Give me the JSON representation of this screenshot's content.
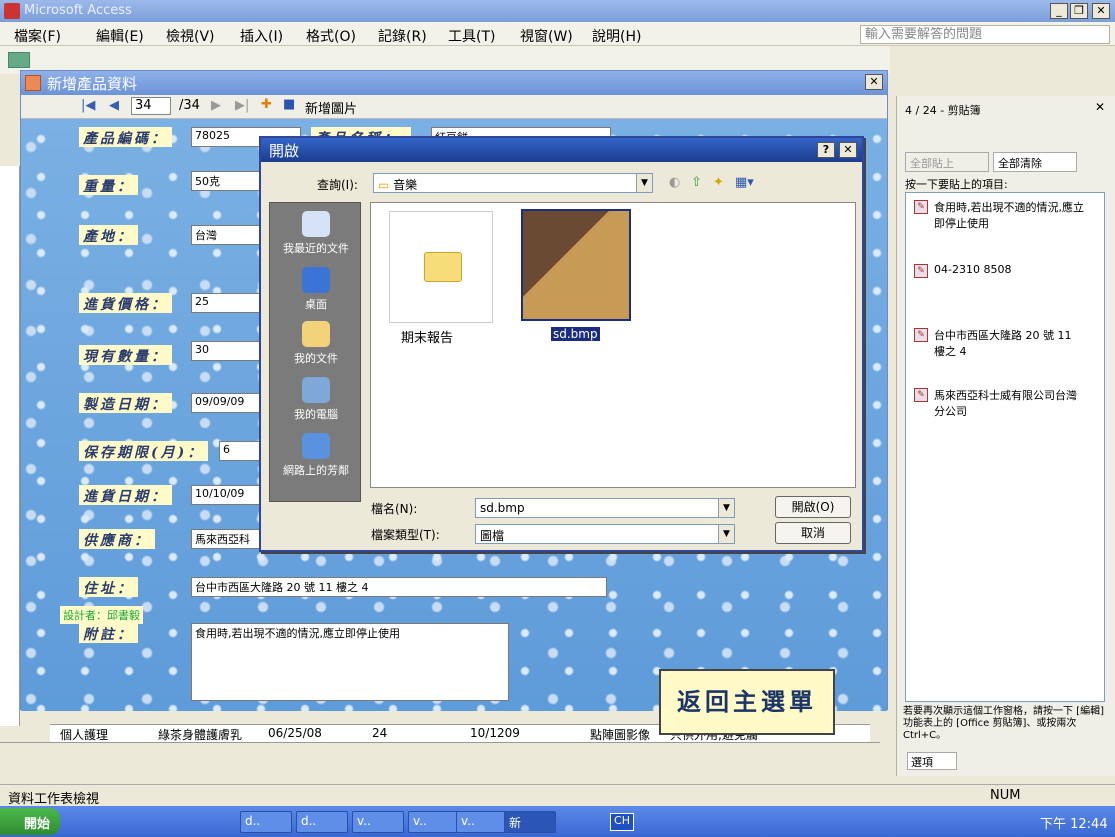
{
  "app": {
    "title": "Microsoft Access"
  },
  "menu": {
    "items": [
      "檔案(F)",
      "編輯(E)",
      "檢視(V)",
      "插入(I)",
      "格式(O)",
      "記錄(R)",
      "工具(T)",
      "視窗(W)",
      "說明(H)"
    ],
    "ask_placeholder": "輸入需要解答的問題"
  },
  "form": {
    "title": "新增產品資料",
    "nav": {
      "current": "34",
      "total": "/34",
      "add_picture": "新增圖片"
    },
    "fields": [
      {
        "label": "產品編碼：",
        "value": "78025"
      },
      {
        "label": "重量：",
        "value": "50克"
      },
      {
        "label": "產地：",
        "value": "台灣"
      },
      {
        "label": "進貨價格：",
        "value": "25"
      },
      {
        "label": "現有數量：",
        "value": "30"
      },
      {
        "label": "製造日期：",
        "value": "09/09/09"
      },
      {
        "label": "保存期限(月)：",
        "value": "6"
      },
      {
        "label": "進貨日期：",
        "value": "10/10/09"
      },
      {
        "label": "供應商：",
        "value": "馬來西亞科"
      },
      {
        "label": "住址：",
        "value": "台中市西區大隆路 20 號 11 樓之 4"
      },
      {
        "label": "附註：",
        "value": "食用時,若出現不適的情況,應立即停止使用"
      }
    ],
    "name_label_partial": "產品名稱：",
    "name_value_partial": "紅豆餅",
    "designer": "設計者：邱書毅",
    "return_button": "返回主選單"
  },
  "sheet": {
    "row": [
      "個人護理",
      "綠茶身體護膚乳",
      "06/25/08",
      "24",
      "10/1209",
      "點陣圖影像",
      "只供外用,避免觸"
    ]
  },
  "dialog": {
    "title": "開啟",
    "lookin_label": "查詢(I):",
    "lookin_value": "音樂",
    "places": [
      "我最近的文件",
      "桌面",
      "我的文件",
      "我的電腦",
      "網路上的芳鄰"
    ],
    "files": [
      {
        "name": "期末報告",
        "type": "folder"
      },
      {
        "name": "sd.bmp",
        "type": "image"
      }
    ],
    "filename_label": "檔名(N):",
    "filename_value": "sd.bmp",
    "filetype_label": "檔案類型(T):",
    "filetype_value": "圖檔",
    "open_button": "開啟(O)",
    "cancel_button": "取消"
  },
  "clipboard": {
    "title": "4 / 24 - 剪貼簿",
    "paste_all": "全部貼上",
    "clear_all": "全部清除",
    "instruction": "按一下要貼上的項目:",
    "items": [
      "食用時,若出現不適的情況,應立即停止使用",
      "04-2310 8508",
      "台中市西區大隆路 20 號 11 樓之 4",
      "馬來西亞科士威有限公司台灣分公司"
    ],
    "footer": "若要再次顯示這個工作窗格，請按一下 [編輯] 功能表上的 [Office 剪貼簿]、或按兩次 Ctrl+C。",
    "options": "選項"
  },
  "status": {
    "left": "資料工作表檢視",
    "num": "NUM"
  },
  "taskbar": {
    "start": "開始",
    "tasks": [
      "d..",
      "d..",
      "v..",
      "v..",
      "v..",
      "新"
    ],
    "lang": "CH",
    "clock": "下午 12:44"
  }
}
